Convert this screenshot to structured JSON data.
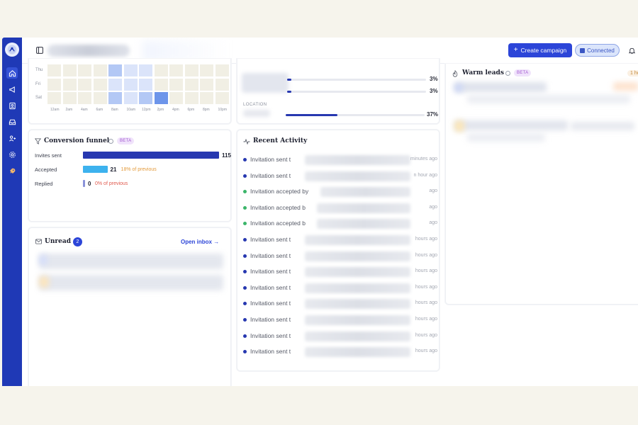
{
  "topbar": {
    "create_label": "Create campaign",
    "connected_label": "Connected"
  },
  "sidebar": {
    "items": [
      "home-icon",
      "megaphone-icon",
      "contacts-icon",
      "inbox-icon",
      "users-icon",
      "gear-icon",
      "rocket-icon"
    ]
  },
  "heatmap": {
    "rows": [
      "Thu",
      "Fri",
      "Sat"
    ],
    "x_labels": [
      "12am",
      "2am",
      "4am",
      "6am",
      "8am",
      "10am",
      "12pm",
      "2pm",
      "4pm",
      "6pm",
      "8pm",
      "10pm"
    ]
  },
  "location": {
    "label": "LOCATION",
    "rows": [
      {
        "pct": "3%",
        "value": 0.03
      },
      {
        "pct": "3%",
        "value": 0.03
      },
      {
        "pct": "37%",
        "value": 0.37
      }
    ]
  },
  "funnel": {
    "title": "Conversion funnel",
    "beta": "BETA",
    "rows": [
      {
        "label": "Invites sent",
        "value": "115",
        "note": "",
        "fraction": 1.0,
        "color": "#2738b0"
      },
      {
        "label": "Accepted",
        "value": "21",
        "note": "18% of previous",
        "fraction": 0.18,
        "color": "#3db2ee",
        "note_color": "#e39a3b"
      },
      {
        "label": "Replied",
        "value": "0",
        "note": "0% of previous",
        "fraction": 0.0,
        "color": "#8b93d9",
        "note_color": "#e05a4e"
      }
    ]
  },
  "activity": {
    "title": "Recent Activity",
    "items": [
      {
        "text": "Invitation sent t",
        "time": "minutes ago",
        "dot": "#2738b0"
      },
      {
        "text": "Invitation sent t",
        "time": "n hour ago",
        "dot": "#2738b0"
      },
      {
        "text": "Invitation accepted by",
        "time": "ago",
        "dot": "#3bb56a"
      },
      {
        "text": "Invitation accepted b",
        "time": "ago",
        "dot": "#3bb56a"
      },
      {
        "text": "Invitation accepted b",
        "time": "ago",
        "dot": "#3bb56a"
      },
      {
        "text": "Invitation sent t",
        "time": "hours ago",
        "dot": "#2738b0"
      },
      {
        "text": "Invitation sent t",
        "time": "hours ago",
        "dot": "#2738b0"
      },
      {
        "text": "Invitation sent t",
        "time": "hours ago",
        "dot": "#2738b0"
      },
      {
        "text": "Invitation sent t",
        "time": "hours ago",
        "dot": "#2738b0"
      },
      {
        "text": "Invitation sent t",
        "time": "hours ago",
        "dot": "#2738b0"
      },
      {
        "text": "Invitation sent t",
        "time": "hours ago",
        "dot": "#2738b0"
      },
      {
        "text": "Invitation sent t",
        "time": "hours ago",
        "dot": "#2738b0"
      },
      {
        "text": "Invitation sent t",
        "time": "hours ago",
        "dot": "#2738b0"
      }
    ]
  },
  "unread": {
    "title": "Unread",
    "count": "2",
    "open_inbox": "Open inbox →"
  },
  "warm_leads": {
    "title": "Warm leads",
    "beta": "BETA",
    "corner": "1 ho"
  },
  "colors": {
    "brand": "#1f39b6",
    "primary_button": "#2c45d8"
  }
}
